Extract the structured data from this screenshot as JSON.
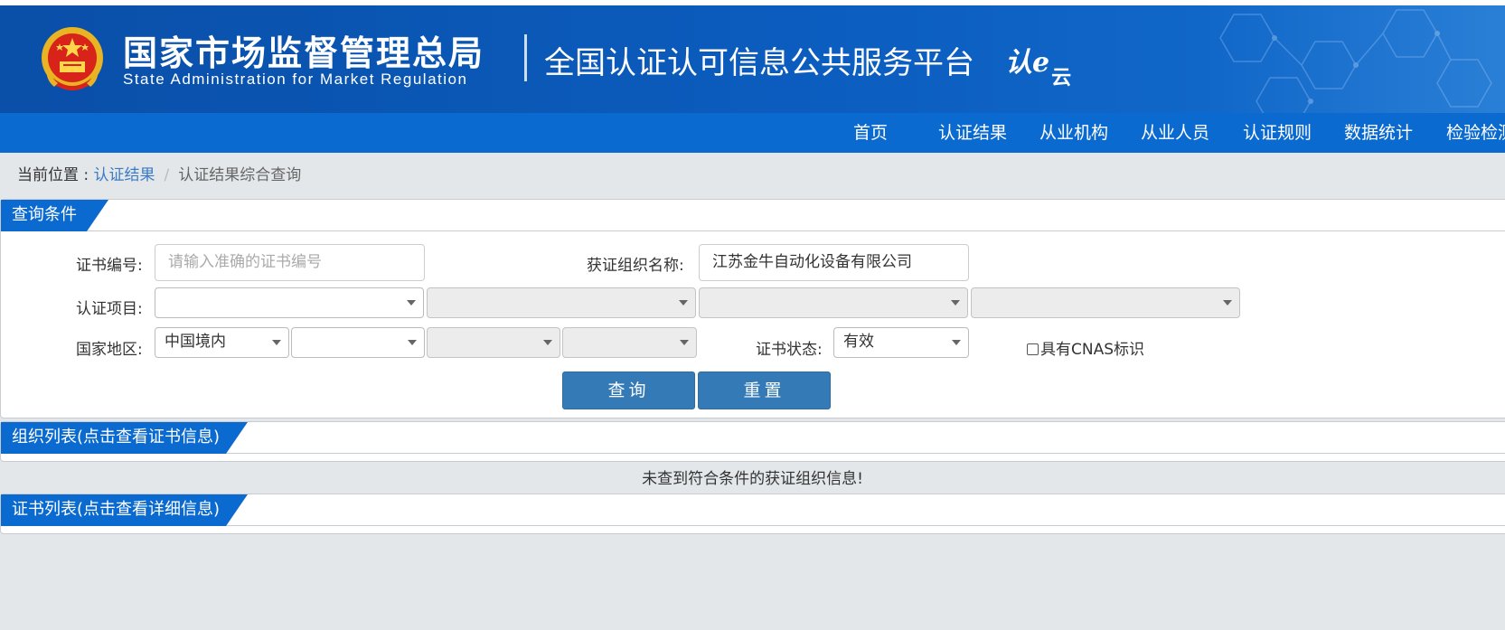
{
  "header": {
    "agency_cn": "国家市场监督管理总局",
    "agency_en": "State Administration  for  Market Regulation",
    "platform_title": "全国认证认可信息公共服务平台",
    "logo_main": "认e",
    "logo_sub": "云"
  },
  "nav": {
    "items": [
      {
        "label": "首页"
      },
      {
        "label": "认证结果"
      },
      {
        "label": "从业机构"
      },
      {
        "label": "从业人员"
      },
      {
        "label": "认证规则"
      },
      {
        "label": "数据统计"
      },
      {
        "label": "检验检测"
      }
    ]
  },
  "breadcrumb": {
    "prefix": "当前位置 : ",
    "link": "认证结果",
    "separator": "/",
    "current": "认证结果综合查询"
  },
  "query_panel": {
    "title": "查询条件",
    "cert_no_label": "证书编号:",
    "cert_no_placeholder": "请输入准确的证书编号",
    "org_name_label": "获证组织名称:",
    "org_name_value": "江苏金牛自动化设备有限公司",
    "cert_item_label": "认证项目:",
    "region_label": "国家地区:",
    "region_value": "中国境内",
    "status_label": "证书状态:",
    "status_value": "有效",
    "cnas_label": "具有CNAS标识",
    "search_button": "查询",
    "reset_button": "重置"
  },
  "org_list": {
    "title": "组织列表(点击查看证书信息)",
    "empty_message": "未查到符合条件的获证组织信息!"
  },
  "cert_list": {
    "title": "证书列表(点击查看详细信息)"
  },
  "colors": {
    "header_blue": "#0b5dbf",
    "nav_blue": "#0a6ad0",
    "button_blue": "#337ab7",
    "link_blue": "#3a7cc4",
    "page_bg": "#e4e7ea"
  }
}
